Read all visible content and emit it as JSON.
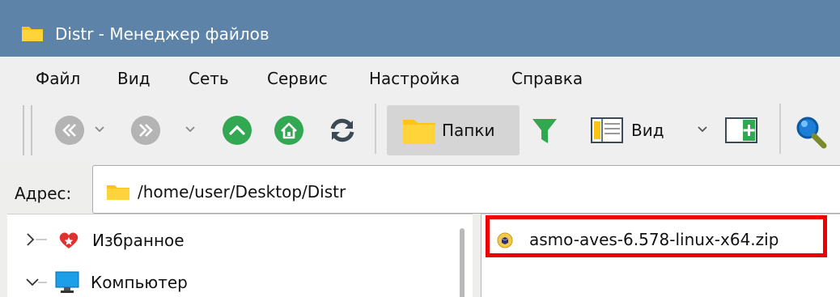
{
  "window": {
    "title": "Distr - Менеджер файлов"
  },
  "menu": {
    "items": [
      "Файл",
      "Вид",
      "Сеть",
      "Сервис",
      "Настройка",
      "Справка"
    ]
  },
  "toolbar": {
    "back_icon": "back-icon",
    "forward_icon": "forward-icon",
    "up_icon": "up-icon",
    "home_icon": "home-icon",
    "refresh_icon": "refresh-icon",
    "folders_label": "Папки",
    "filter_icon": "filter-icon",
    "view_label": "Вид",
    "search_icon": "search-icon"
  },
  "address": {
    "label": "Адрес:",
    "value": "/home/user/Desktop/Distr"
  },
  "tree": {
    "items": [
      {
        "label": "Избранное",
        "icon": "favorites-heart-icon",
        "expanded": false
      },
      {
        "label": "Компьютер",
        "icon": "computer-icon",
        "expanded": true
      }
    ]
  },
  "files": [
    {
      "name": "asmo-aves-6.578-linux-x64.zip",
      "icon": "zip-archive-icon",
      "highlighted": true
    }
  ],
  "colors": {
    "titlebar": "#5d84a8",
    "highlight_border": "#ee0000",
    "folder_yellow": "#fcc419",
    "green_button": "#33a852"
  }
}
